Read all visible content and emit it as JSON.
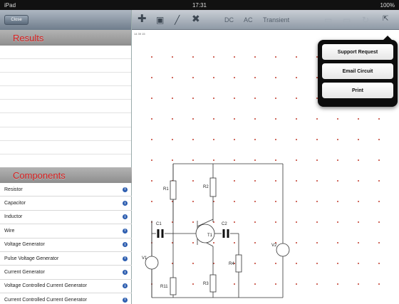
{
  "status": {
    "left": "iPad",
    "time": "17:31",
    "right": "100%"
  },
  "sidebar": {
    "close_label": "Close",
    "results_title": "Results",
    "components_title": "Components",
    "components": [
      "Resistor",
      "Capacitor",
      "Inductor",
      "Wire",
      "Voltage Generator",
      "Pulse Voltage Generator",
      "Current Generator",
      "Voltage Controlled Current Generator",
      "Current Controlled Current Generator"
    ]
  },
  "toolbar": {
    "icons": [
      "add-icon",
      "save-icon",
      "pencil-icon",
      "delete-icon",
      "share-icon"
    ],
    "dc_label": "DC",
    "ac_label": "AC",
    "transient_label": "Transient"
  },
  "canvas": {
    "coord_text": "14 39 15"
  },
  "menu": {
    "items": [
      "Support Request",
      "Email Circuit",
      "Print"
    ]
  },
  "circuit": {
    "labels": {
      "r1": "R1",
      "r2": "R2",
      "r3": "R3",
      "r4": "R4",
      "r11": "R11",
      "c1": "C1",
      "c2": "C2",
      "t1": "T1",
      "v1": "V1",
      "v2": "V2"
    }
  },
  "colors": {
    "dot": "#c0392b",
    "results_title": "#d61f1f",
    "info": "#2f5fb0"
  }
}
